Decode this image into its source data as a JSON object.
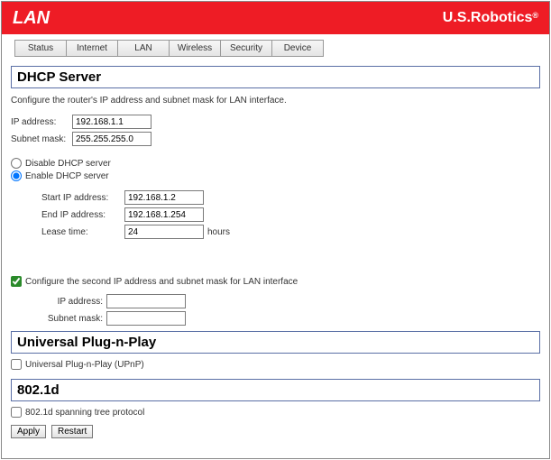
{
  "header": {
    "title": "LAN",
    "brand": "U.S.Robotics",
    "brand_reg": "®"
  },
  "tabs": [
    "Status",
    "Internet",
    "LAN",
    "Wireless",
    "Security",
    "Device"
  ],
  "dhcp": {
    "section_title": "DHCP Server",
    "description": "Configure the router's IP address and subnet mask for LAN interface.",
    "ip_label": "IP address:",
    "ip_value": "192.168.1.1",
    "subnet_label": "Subnet mask:",
    "subnet_value": "255.255.255.0",
    "disable_label": "Disable DHCP server",
    "enable_label": "Enable DHCP server",
    "start_ip_label": "Start IP address:",
    "start_ip_value": "192.168.1.2",
    "end_ip_label": "End IP address:",
    "end_ip_value": "192.168.1.254",
    "lease_label": "Lease time:",
    "lease_value": "24",
    "lease_unit": "hours",
    "second_ip_check": "Configure the second IP address and subnet mask for LAN interface",
    "second_ip_label": "IP address:",
    "second_ip_value": "",
    "second_subnet_label": "Subnet mask:",
    "second_subnet_value": ""
  },
  "upnp": {
    "section_title": "Universal Plug-n-Play",
    "check_label": "Universal Plug-n-Play (UPnP)"
  },
  "stp": {
    "section_title": "802.1d",
    "check_label": "802.1d spanning tree protocol"
  },
  "buttons": {
    "apply": "Apply",
    "restart": "Restart"
  }
}
